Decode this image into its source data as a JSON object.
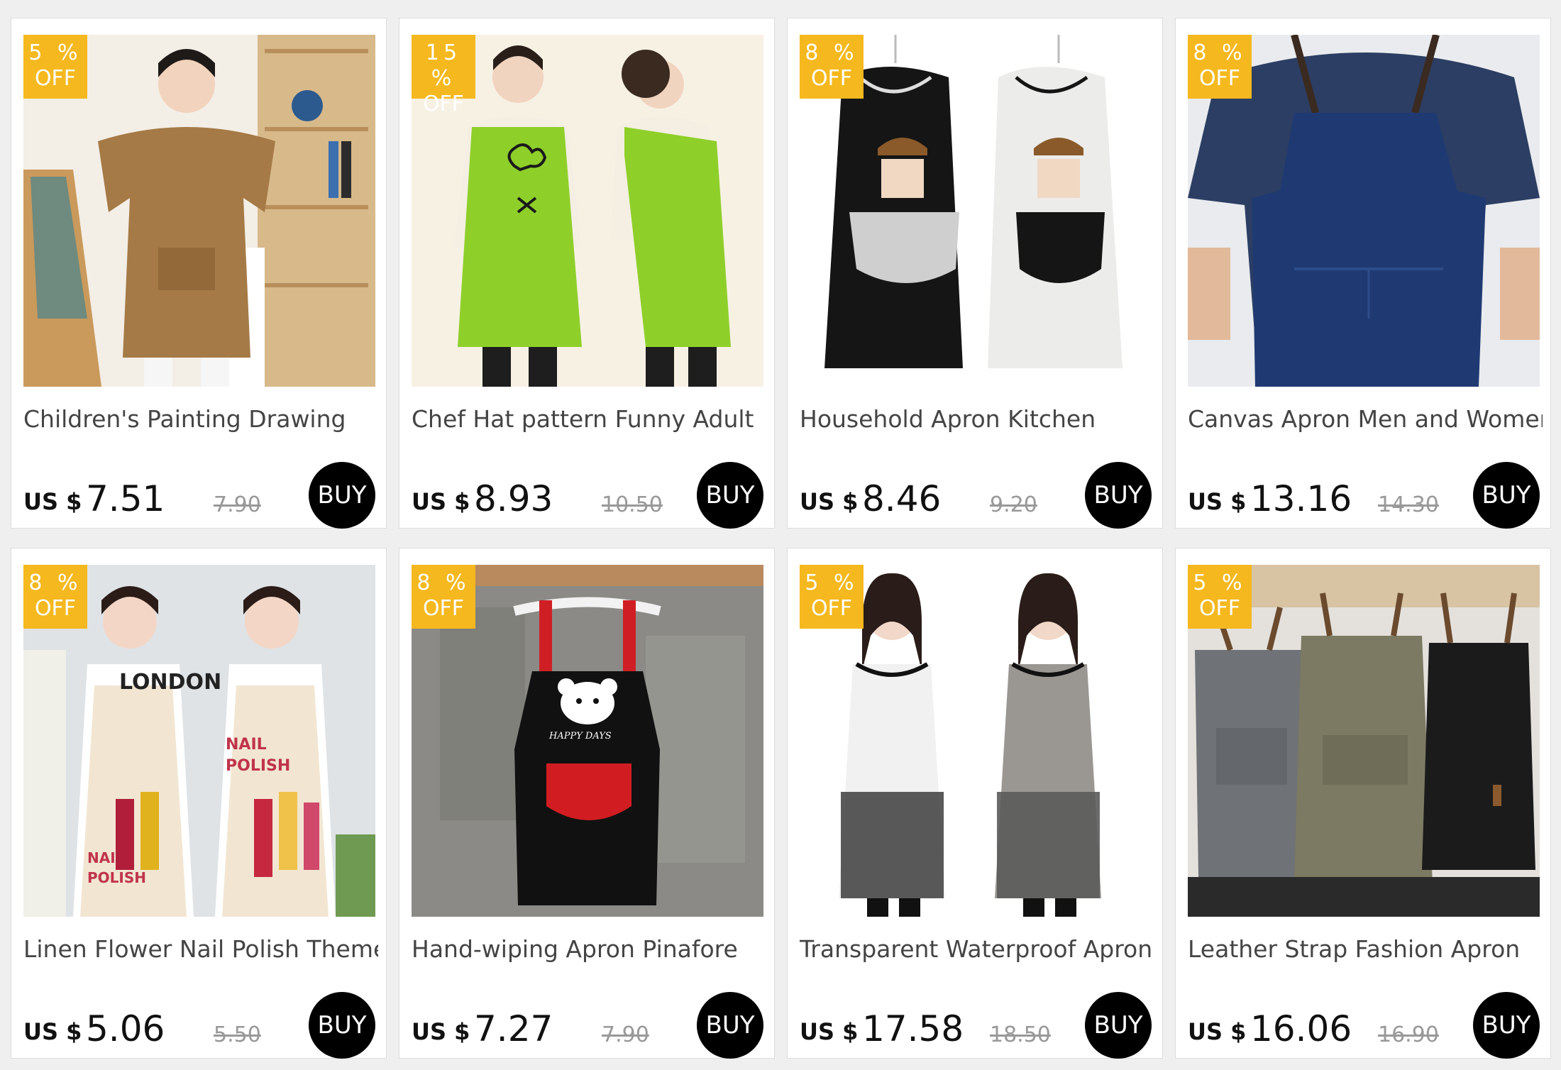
{
  "currency_label": "US $",
  "buy_label": "BUY",
  "off_label": "OFF",
  "products": [
    {
      "discount": "5 %",
      "title": "Children's Painting Drawing",
      "price": "7.51",
      "old_price": "7.90",
      "image": "child-brown-smock-apron"
    },
    {
      "discount": "15 %",
      "title": "Chef Hat pattern Funny Adult",
      "price": "8.93",
      "old_price": "10.50",
      "image": "green-chef-hat-apron"
    },
    {
      "discount": "8 %",
      "title": "Household Apron Kitchen",
      "price": "8.46",
      "old_price": "9.20",
      "image": "black-white-girl-print-aprons"
    },
    {
      "discount": "8 %",
      "title": "Canvas Apron Men and Women",
      "price": "13.16",
      "old_price": "14.30",
      "image": "navy-canvas-apron"
    },
    {
      "discount": "8 %",
      "title": "Linen Flower Nail Polish Theme",
      "price": "5.06",
      "old_price": "5.50",
      "image": "nail-polish-print-aprons"
    },
    {
      "discount": "8 %",
      "title": "Hand-wiping Apron Pinafore",
      "price": "7.27",
      "old_price": "7.90",
      "image": "black-bear-happy-days-apron"
    },
    {
      "discount": "5 %",
      "title": "Transparent Waterproof Apron",
      "price": "17.58",
      "old_price": "18.50",
      "image": "transparent-waterproof-aprons"
    },
    {
      "discount": "5 %",
      "title": "Leather Strap Fashion Apron",
      "price": "16.06",
      "old_price": "16.90",
      "image": "leather-strap-aprons-three-colors"
    }
  ],
  "image_text": {
    "bear_print": "HAPPY DAYS",
    "nail_print_1": "NAIL",
    "nail_print_2": "POLISH",
    "shirt_print": "LONDON"
  },
  "colors": {
    "badge": "#f5b81e",
    "buy_button": "#000000",
    "page_bg": "#efefef"
  }
}
